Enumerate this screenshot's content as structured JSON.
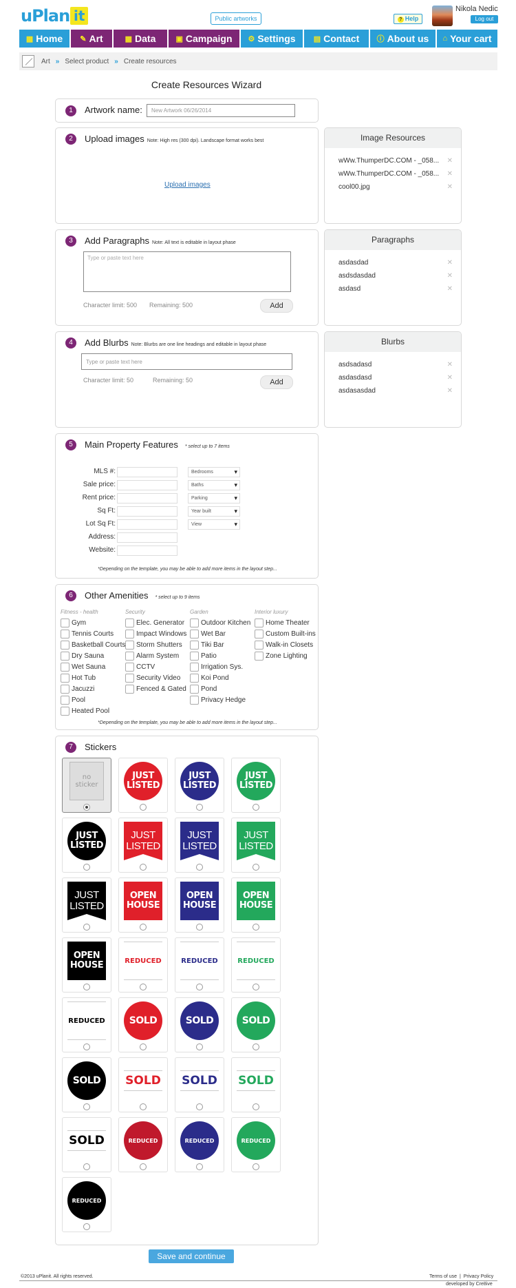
{
  "header": {
    "logo_text": "uPlan",
    "logo_it": "it",
    "public_artworks": "Public artworks",
    "help": "Help",
    "user_name": "Nikola Nedic",
    "logout": "Log out"
  },
  "nav": [
    {
      "label": "Home",
      "icon": "▦"
    },
    {
      "label": "Art",
      "icon": "✎"
    },
    {
      "label": "Data",
      "icon": "▦"
    },
    {
      "label": "Campaign",
      "icon": "▣"
    },
    {
      "label": "Settings",
      "icon": "⚙"
    },
    {
      "label": "Contact",
      "icon": "▤"
    },
    {
      "label": "About us",
      "icon": "ⓘ"
    },
    {
      "label": "Your cart",
      "icon": "⌂"
    }
  ],
  "breadcrumb": [
    "Art",
    "Select product",
    "Create resources"
  ],
  "wizard_title": "Create Resources Wizard",
  "step1": {
    "num": "1",
    "title": "Artwork name:",
    "value": "New Artwork 06/26/2014"
  },
  "step2": {
    "num": "2",
    "title": "Upload images",
    "note": "Note: High res (300 dpi). Landscape format works best",
    "link": "Upload images"
  },
  "step3": {
    "num": "3",
    "title": "Add Paragraphs",
    "note": "Note: All text is editable in layout phase",
    "placeholder": "Type or paste text here",
    "char_limit": "Character limit: 500",
    "remaining": "Remaining: 500",
    "add": "Add"
  },
  "step4": {
    "num": "4",
    "title": "Add Blurbs",
    "note": "Note: Blurbs are one line headings and editable in layout phase",
    "placeholder": "Type or paste text here",
    "char_limit": "Character limit: 50",
    "remaining": "Remaining: 50",
    "add": "Add"
  },
  "image_resources": {
    "title": "Image Resources",
    "items": [
      "wWw.ThumperDC.COM - _058...",
      "wWw.ThumperDC.COM - _058...",
      "cool00.jpg"
    ]
  },
  "paragraphs": {
    "title": "Paragraphs",
    "items": [
      "asdasdad",
      "asdsdasdad",
      "asdasd"
    ]
  },
  "blurbs": {
    "title": "Blurbs",
    "items": [
      "asdsadasd",
      "asdasdasd",
      "asdasasdad"
    ]
  },
  "remove_glyph": "✕",
  "step5": {
    "num": "5",
    "title": "Main Property Features",
    "note": "* select up to 7 items",
    "labels": [
      "MLS #:",
      "Sale price:",
      "Rent price:",
      "Sq Ft:",
      "Lot Sq Ft:",
      "Address:",
      "Website:"
    ],
    "selects": [
      "Bedrooms",
      "Baths",
      "Parking",
      "Year built",
      "View"
    ],
    "footnote": "*Depending on the template, you may be able to add more items in the layout step..."
  },
  "step6": {
    "num": "6",
    "title": "Other Amenities",
    "note": "* select up to 9 items",
    "columns": [
      {
        "head": "Fitness - health",
        "items": [
          "Gym",
          "Tennis Courts",
          "Basketball Courts",
          "Dry Sauna",
          "Wet Sauna",
          "Hot Tub",
          "Jacuzzi",
          "Pool",
          "Heated Pool"
        ]
      },
      {
        "head": "Security",
        "items": [
          "Elec. Generator",
          "Impact Windows",
          "Storm Shutters",
          "Alarm System",
          "CCTV",
          "Security Video",
          "Fenced & Gated"
        ]
      },
      {
        "head": "Garden",
        "items": [
          "Outdoor Kitchen",
          "Wet Bar",
          "Tiki Bar",
          "Patio",
          "Irrigation Sys.",
          "Koi Pond",
          "Pond",
          "Privacy Hedge"
        ]
      },
      {
        "head": "Interior luxury",
        "items": [
          "Home Theater",
          "Custom Built-ins",
          "Walk-in Closets",
          "Zone Lighting"
        ]
      }
    ],
    "footnote": "*Depending on the template, you may be able to add more items in the layout step..."
  },
  "step7": {
    "num": "7",
    "title": "Stickers",
    "stickers": [
      {
        "label": "no sticker",
        "style": "none",
        "selected": true
      },
      {
        "label": "JUST LISTED",
        "style": "circle",
        "color": "#e0202a"
      },
      {
        "label": "JUST LISTED",
        "style": "circle",
        "color": "#2b2c8a"
      },
      {
        "label": "JUST LISTED",
        "style": "circle",
        "color": "#23a85c"
      },
      {
        "label": "JUST LISTED",
        "style": "circle",
        "color": "#000000"
      },
      {
        "label": "JUST LISTED",
        "style": "flag",
        "color": "#e0202a"
      },
      {
        "label": "JUST LISTED",
        "style": "flag",
        "color": "#2b2c8a"
      },
      {
        "label": "JUST LISTED",
        "style": "flag",
        "color": "#23a85c"
      },
      {
        "label": "JUST LISTED",
        "style": "flag",
        "color": "#000000"
      },
      {
        "label": "OPEN HOUSE",
        "style": "square",
        "color": "#e0202a"
      },
      {
        "label": "OPEN HOUSE",
        "style": "square",
        "color": "#2b2c8a"
      },
      {
        "label": "OPEN HOUSE",
        "style": "square",
        "color": "#23a85c"
      },
      {
        "label": "OPEN HOUSE",
        "style": "square",
        "color": "#000000"
      },
      {
        "label": "REDUCED",
        "style": "text",
        "color": "#e0202a"
      },
      {
        "label": "REDUCED",
        "style": "text",
        "color": "#2b2c8a"
      },
      {
        "label": "REDUCED",
        "style": "text",
        "color": "#23a85c"
      },
      {
        "label": "REDUCED",
        "style": "text",
        "color": "#000000"
      },
      {
        "label": "SOLD",
        "style": "circle",
        "color": "#e0202a"
      },
      {
        "label": "SOLD",
        "style": "circle",
        "color": "#2b2c8a"
      },
      {
        "label": "SOLD",
        "style": "circle",
        "color": "#23a85c"
      },
      {
        "label": "SOLD",
        "style": "circle",
        "color": "#000000"
      },
      {
        "label": "SOLD",
        "style": "textbig",
        "color": "#e0202a"
      },
      {
        "label": "SOLD",
        "style": "textbig",
        "color": "#2b2c8a"
      },
      {
        "label": "SOLD",
        "style": "textbig",
        "color": "#23a85c"
      },
      {
        "label": "SOLD",
        "style": "textbig",
        "color": "#000000"
      },
      {
        "label": "REDUCED",
        "style": "circle",
        "color": "#c0192c"
      },
      {
        "label": "REDUCED",
        "style": "circle",
        "color": "#2b2c8a"
      },
      {
        "label": "REDUCED",
        "style": "circle",
        "color": "#23a85c"
      },
      {
        "label": "REDUCED",
        "style": "circle",
        "color": "#000000"
      }
    ]
  },
  "save_button": "Save and continue",
  "footer": {
    "copyright": "©2013 uPlanit. All rights reserved.",
    "terms": "Terms of use",
    "sep": "|",
    "privacy": "Privacy Policy",
    "developer": "developed by Cre8ive"
  }
}
